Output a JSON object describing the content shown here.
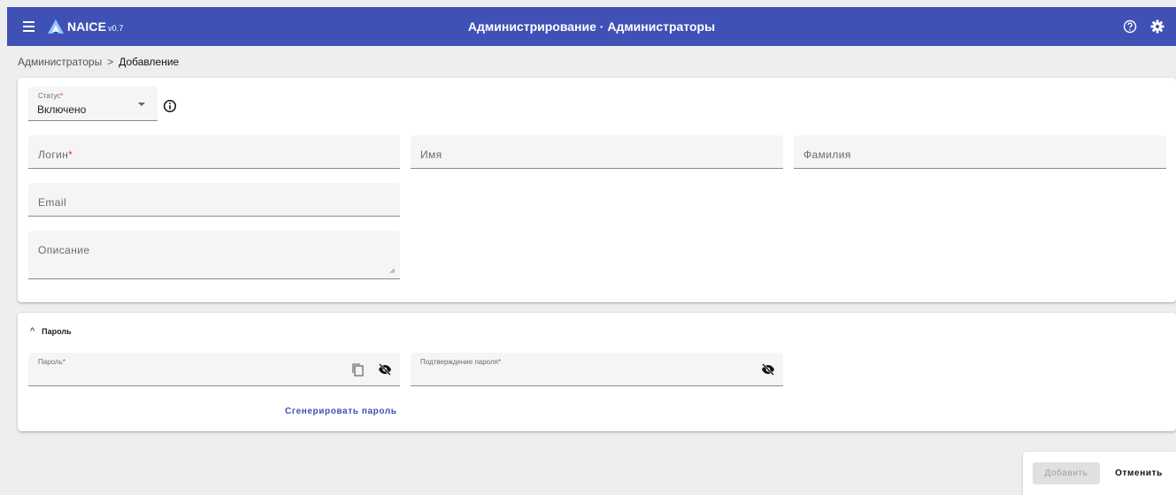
{
  "app": {
    "brand": "NAICE",
    "version": "v0.7",
    "title": "Администрирование · Администраторы"
  },
  "icons": {
    "menu": "menu-icon",
    "logo": "naice-logo-icon",
    "help": "help-icon",
    "settings": "gear-icon",
    "info": "info-icon",
    "copy": "copy-icon",
    "visibility": "eye-off-icon",
    "expand": "chevron-up-icon"
  },
  "colors": {
    "header": "#3f51b5",
    "required": "#e53935",
    "link": "#3f51b5"
  },
  "breadcrumb": {
    "parent": "Администраторы",
    "separator": ">",
    "current": "Добавление"
  },
  "form": {
    "status": {
      "label": "Статус",
      "required_mark": "*",
      "value": "Включено"
    },
    "login": {
      "label": "Логин",
      "required_mark": "*",
      "value": ""
    },
    "name": {
      "label": "Имя",
      "value": ""
    },
    "surname": {
      "label": "Фамилия",
      "value": ""
    },
    "email": {
      "label": "Email",
      "value": ""
    },
    "description": {
      "label": "Описание",
      "value": ""
    }
  },
  "password_section": {
    "title": "Пароль",
    "chevron": "^",
    "password": {
      "label": "Пароль",
      "required_mark": "*"
    },
    "confirm": {
      "label": "Подтверждение пароля",
      "required_mark": "*"
    },
    "generate_label": "Сгенерировать пароль"
  },
  "actions": {
    "add_label": "Добавить",
    "cancel_label": "Отменить"
  }
}
